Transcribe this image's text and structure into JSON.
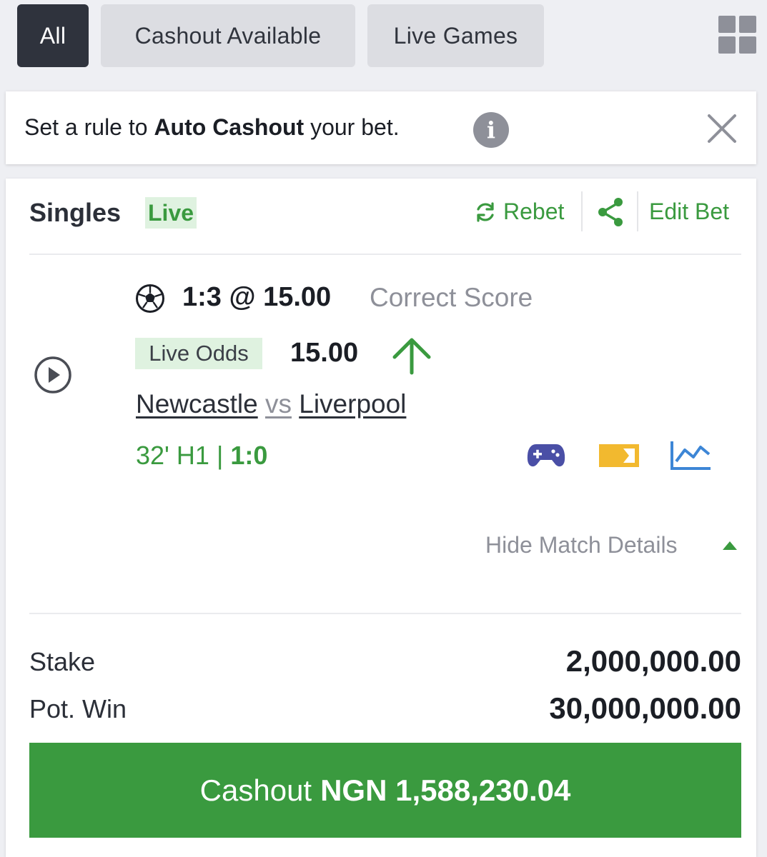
{
  "filters": {
    "all": "All",
    "cashout_available": "Cashout Available",
    "live_games": "Live Games",
    "active": "All"
  },
  "banner": {
    "text_before": "Set a rule to ",
    "text_bold": "Auto Cashout",
    "text_after": " your bet.",
    "info_glyph": "i"
  },
  "bet": {
    "type": "Singles",
    "live_tag": "Live",
    "rebet_label": "Rebet",
    "edit_bet_label": "Edit Bet",
    "selection": "1:3 @ 15.00",
    "market": "Correct Score",
    "live_odds_label": "Live Odds",
    "live_odds_value": "15.00",
    "odds_trend": "up",
    "home_team": "Newcastle",
    "vs": "vs",
    "away_team": "Liverpool",
    "match_clock": "32' H1 |",
    "match_score": "1:0",
    "hide_details_label": "Hide Match Details",
    "stake_label": "Stake",
    "stake_value": "2,000,000.00",
    "pot_win_label": "Pot. Win",
    "pot_win_value": "30,000,000.00",
    "cashout_prefix": "Cashout",
    "cashout_amount": "NGN 1,588,230.04"
  },
  "icons": {
    "grid": "grid-view-icon",
    "info": "info-icon",
    "close": "close-icon",
    "rebet": "refresh-icon",
    "share": "share-icon",
    "play": "play-circle-icon",
    "sport": "soccer-ball-icon",
    "trend": "arrow-up-icon",
    "game": "gamepad-icon",
    "card": "ticket-icon",
    "stats": "line-chart-icon",
    "collapse": "caret-up-icon"
  },
  "colors": {
    "accent_green": "#3a9a3f",
    "live_tag_bg": "#dff2e0",
    "active_chip": "#2f333d",
    "inactive_chip": "#dcdde2",
    "gamepad": "#4a4fa6",
    "ticket": "#f2b92f",
    "chart": "#3d86d6"
  }
}
